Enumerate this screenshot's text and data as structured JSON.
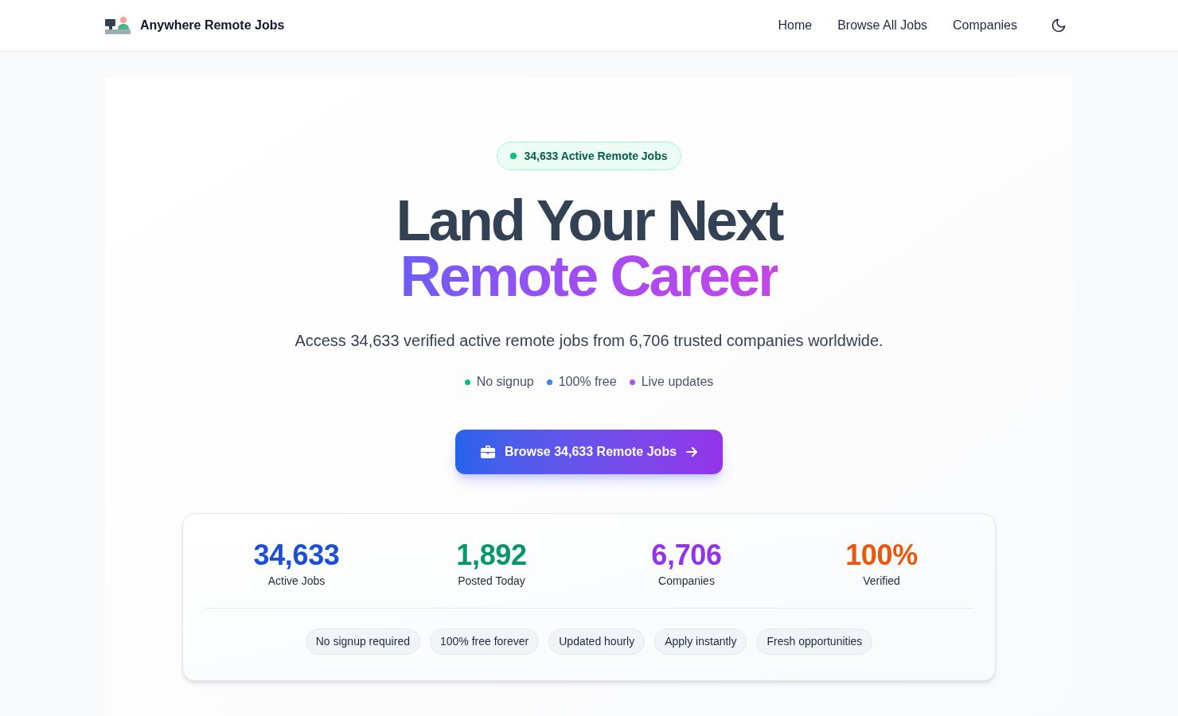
{
  "header": {
    "logo_text": "Anywhere Remote Jobs",
    "nav": [
      {
        "label": "Home"
      },
      {
        "label": "Browse All Jobs"
      },
      {
        "label": "Companies"
      }
    ]
  },
  "hero": {
    "badge": {
      "text": "34,633 Active Remote Jobs"
    },
    "headline": {
      "line_1": "Land Your Next",
      "line_2": "Remote Career"
    },
    "subtitle": "Access 34,633 verified active remote jobs from 6,706 trusted companies worldwide.",
    "highlights": [
      {
        "text": "No signup",
        "color": "#10b981"
      },
      {
        "text": "100% free",
        "color": "#3b82f6"
      },
      {
        "text": "Live updates",
        "color": "#a855f7"
      }
    ],
    "cta": {
      "label": "Browse 34,633 Remote Jobs"
    }
  },
  "stats": {
    "items": [
      {
        "value": "34,633",
        "label": "Active Jobs",
        "color": "#1d4ed8"
      },
      {
        "value": "1,892",
        "label": "Posted Today",
        "color": "#059669"
      },
      {
        "value": "6,706",
        "label": "Companies",
        "color": "#9333ea"
      },
      {
        "value": "100%",
        "label": "Verified",
        "color": "#ea580c"
      }
    ],
    "tags": [
      {
        "text": "No signup required"
      },
      {
        "text": "100% free forever"
      },
      {
        "text": "Updated hourly"
      },
      {
        "text": "Apply instantly"
      },
      {
        "text": "Fresh opportunities"
      }
    ]
  }
}
